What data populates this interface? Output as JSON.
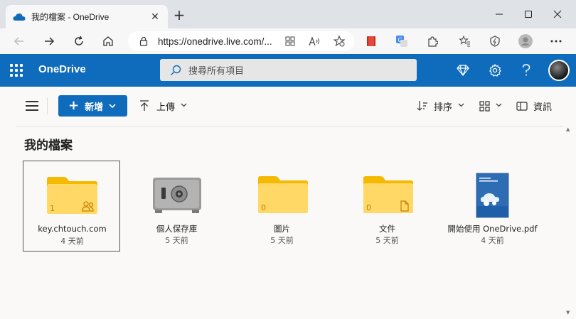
{
  "browser": {
    "tab_title": "我的檔案 - OneDrive",
    "tab_close": "✕",
    "new_tab": "+",
    "url": "https://onedrive.live.com/..."
  },
  "header": {
    "app_name": "OneDrive",
    "search_placeholder": "搜尋所有項目"
  },
  "toolbar": {
    "new_label": "新增",
    "upload_label": "上傳",
    "sort_label": "排序",
    "info_label": "資訊"
  },
  "page_title": "我的檔案",
  "items": [
    {
      "name": "key.chtouch.com",
      "date": "4 天前",
      "type": "shared-folder",
      "count": "1"
    },
    {
      "name": "個人保存庫",
      "date": "5 天前",
      "type": "vault"
    },
    {
      "name": "圖片",
      "date": "5 天前",
      "type": "folder",
      "count": "0"
    },
    {
      "name": "文件",
      "date": "5 天前",
      "type": "document-folder",
      "count": "0"
    },
    {
      "name": "開始使用 OneDrive.pdf",
      "date": "4 天前",
      "type": "pdf"
    }
  ],
  "colors": {
    "brand_blue": "#0f6cbd",
    "folder_yellow": "#ffd866",
    "folder_tab": "#f5b900"
  }
}
